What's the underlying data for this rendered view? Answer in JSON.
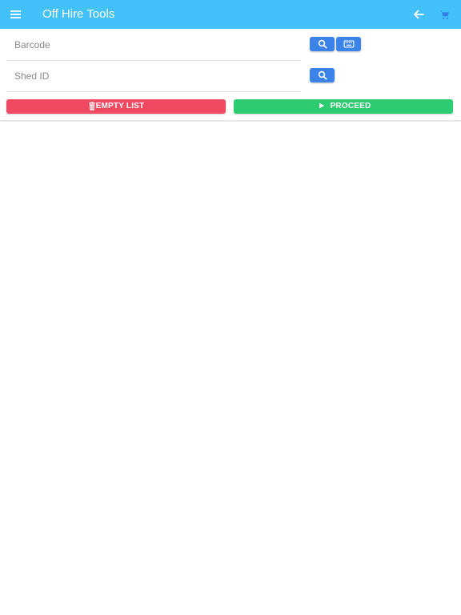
{
  "header": {
    "title": "Off Hire Tools",
    "background_color": "#43c1fb",
    "menu_icon": "hamburger-menu-icon",
    "back_icon": "arrow-left-icon",
    "cart_icon": "shopping-cart-icon"
  },
  "form": {
    "barcode": {
      "placeholder": "Barcode",
      "value": ""
    },
    "shed_id": {
      "placeholder": "Shed ID",
      "value": ""
    },
    "search_icon": "search-icon",
    "keyboard_icon": "keyboard-icon",
    "button_color": "#3b82e9"
  },
  "actions": {
    "empty_list": {
      "label": "EMPTY LIST",
      "icon": "trash-icon",
      "color": "#ef4a61"
    },
    "proceed": {
      "label": "PROCEED",
      "icon": "play-icon",
      "color": "#2ecc71"
    }
  }
}
